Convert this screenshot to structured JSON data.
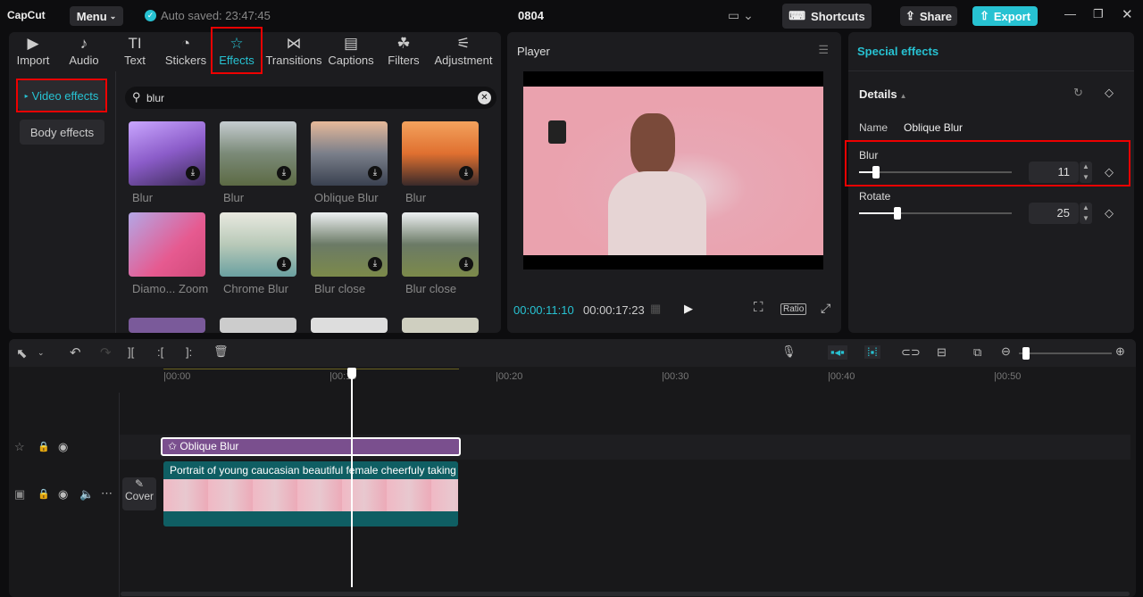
{
  "app": {
    "logo": "CapCut",
    "menu": "Menu",
    "autosave": "Auto saved: 23:47:45",
    "project": "0804",
    "shortcuts": "Shortcuts",
    "share": "Share",
    "export": "Export"
  },
  "tabs": [
    {
      "label": "Import",
      "icon": "▶"
    },
    {
      "label": "Audio",
      "icon": "♪"
    },
    {
      "label": "Text",
      "icon": "TI"
    },
    {
      "label": "Stickers",
      "icon": "◔"
    },
    {
      "label": "Effects",
      "icon": "☆"
    },
    {
      "label": "Transitions",
      "icon": "⋈"
    },
    {
      "label": "Captions",
      "icon": "▤"
    },
    {
      "label": "Filters",
      "icon": "☘"
    },
    {
      "label": "Adjustment",
      "icon": "⚟"
    }
  ],
  "sidebar": {
    "video_effects": "Video effects",
    "body_effects": "Body effects"
  },
  "search": {
    "value": "blur"
  },
  "effects": [
    {
      "label": "Blur",
      "bg": "linear-gradient(160deg,#c9a6ff,#8b5cc9 50%,#3a2a55)"
    },
    {
      "label": "Blur",
      "bg": "linear-gradient(180deg,#c5ccd0,#7b8a78 50%,#5c6a44)"
    },
    {
      "label": "Oblique Blur",
      "bg": "linear-gradient(180deg,#e6b99a,#7a7f8a 50%,#3a4150)"
    },
    {
      "label": "Blur",
      "bg": "linear-gradient(180deg,#f3a25d,#e07030 50%,#3a2a2a)"
    },
    {
      "label": "Diamo... Zoom",
      "bg": "linear-gradient(135deg,#b3a7e6,#e65a90 60%,#d14a7a)"
    },
    {
      "label": "Chrome Blur",
      "bg": "linear-gradient(180deg,#e9e9e0,#b8c9b8 50%,#6aa0a0)"
    },
    {
      "label": "Blur close",
      "bg": "linear-gradient(180deg,#eef1f3,#6b7a66 50%,#7c8a4a)"
    },
    {
      "label": "Blur close",
      "bg": "linear-gradient(180deg,#eef1f3,#6b7a66 50%,#7c8a4a)"
    }
  ],
  "player": {
    "title": "Player",
    "current": "00:00:11:10",
    "total": "00:00:17:23",
    "ratio": "Ratio"
  },
  "right": {
    "title": "Special effects",
    "details": "Details",
    "name_label": "Name",
    "name_value": "Oblique Blur",
    "blur_label": "Blur",
    "blur_value": "11",
    "blur_fraction": 0.11,
    "rotate_label": "Rotate",
    "rotate_value": "25",
    "rotate_fraction": 0.25
  },
  "timeline": {
    "ticks": [
      "00:00",
      "00:10",
      "00:20",
      "00:30",
      "00:40",
      "00:50"
    ],
    "effect_clip": "Oblique Blur",
    "video_clip": "Portrait of young caucasian beautiful female cheerfuly taking",
    "cover": "Cover"
  },
  "colors": {
    "accent": "#27c2d2",
    "effect_clip": "#7a4f8e",
    "video_clip": "#0f5e63"
  }
}
